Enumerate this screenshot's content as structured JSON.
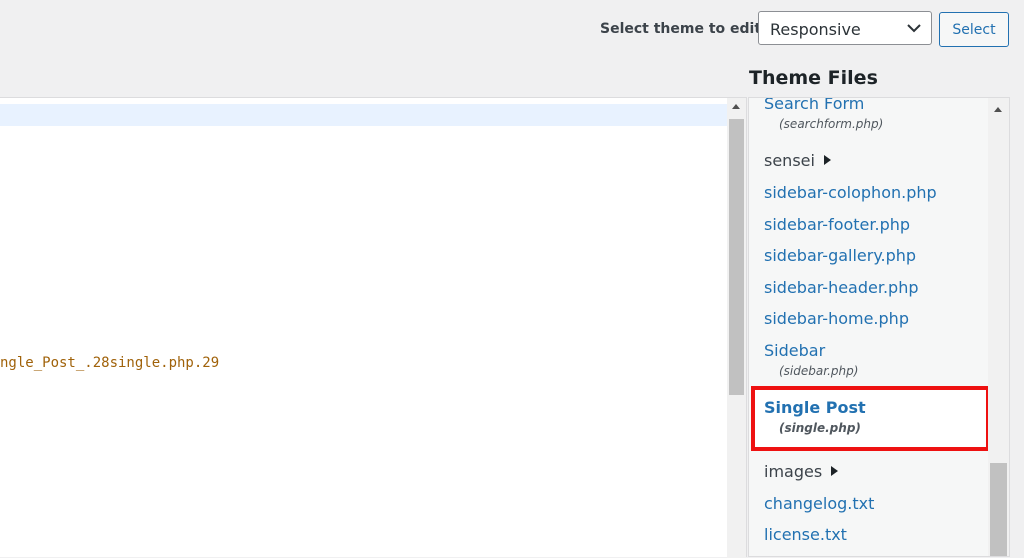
{
  "theme_selector": {
    "label": "Select theme to edit:",
    "selected": "Responsive",
    "button_label": "Select"
  },
  "editor": {
    "visible_code_fragment": "ngle_Post_.28single.php.29"
  },
  "theme_files": {
    "title": "Theme Files",
    "items": [
      {
        "type": "file",
        "name": "Search Form",
        "filename": "(searchform.php)"
      },
      {
        "type": "folder",
        "name": "sensei"
      },
      {
        "type": "file",
        "name": "sidebar-colophon.php"
      },
      {
        "type": "file",
        "name": "sidebar-footer.php"
      },
      {
        "type": "file",
        "name": "sidebar-gallery.php"
      },
      {
        "type": "file",
        "name": "sidebar-header.php"
      },
      {
        "type": "file",
        "name": "sidebar-home.php"
      },
      {
        "type": "file",
        "name": "Sidebar",
        "filename": "(sidebar.php)"
      },
      {
        "type": "file",
        "name": "Single Post",
        "filename": "(single.php)",
        "current": true
      },
      {
        "type": "folder",
        "name": "images"
      },
      {
        "type": "file",
        "name": "changelog.txt"
      },
      {
        "type": "file",
        "name": "license.txt"
      }
    ]
  },
  "colors": {
    "link": "#2271b1",
    "highlight_border": "#ee1111",
    "code_text": "#a0620a",
    "active_line": "#e8f2ff"
  }
}
